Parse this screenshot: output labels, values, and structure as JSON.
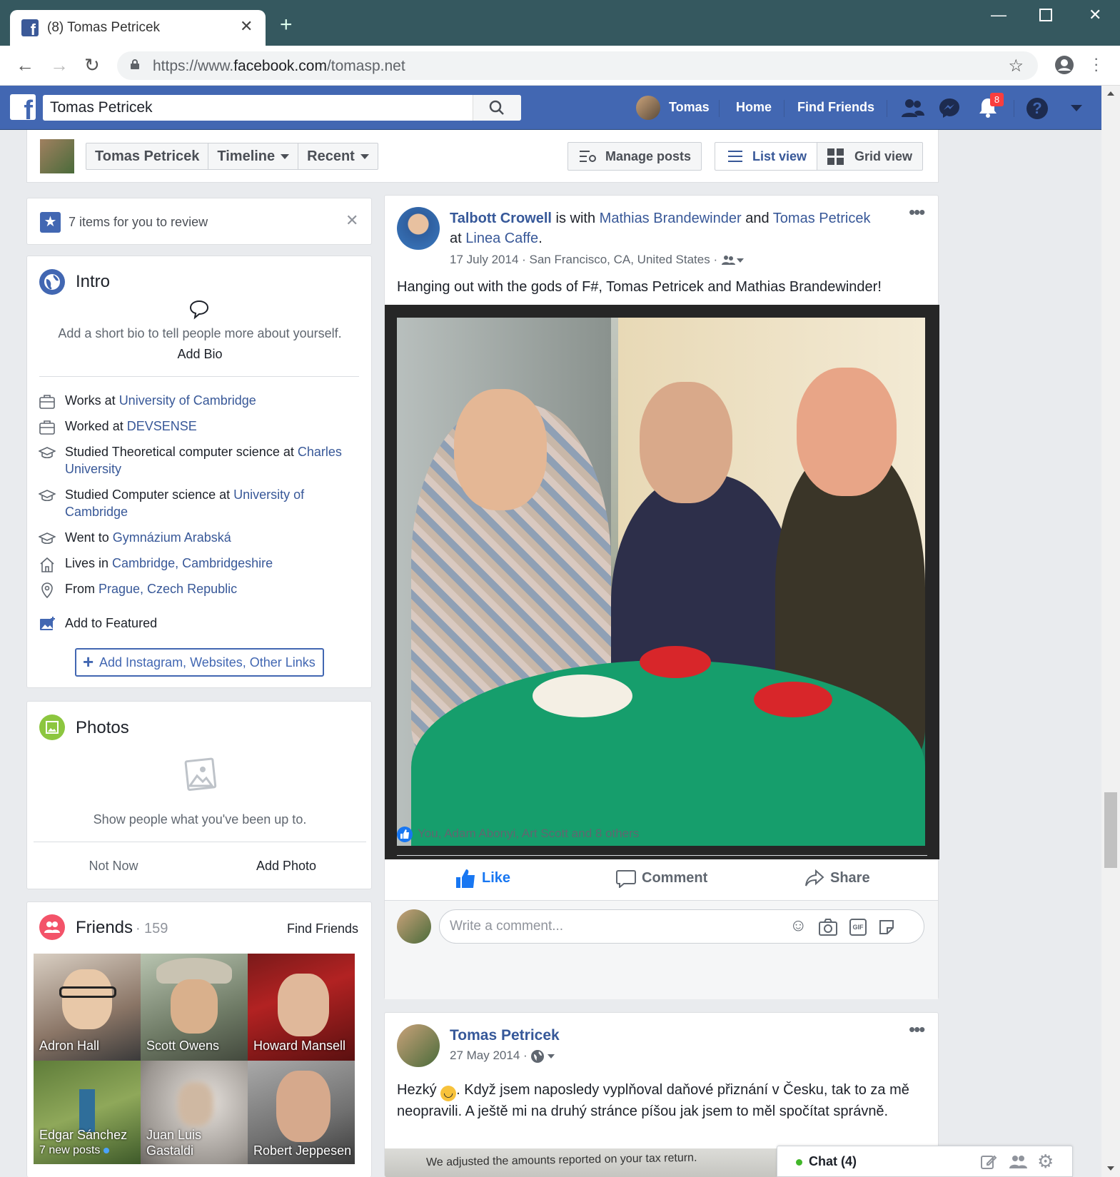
{
  "browser": {
    "tab_title": "(8) Tomas Petricek",
    "url_prefix": "https://www.",
    "url_domain": "facebook.com",
    "url_path": "/tomasp.net"
  },
  "fb_nav": {
    "search_value": "Tomas Petricek",
    "user": "Tomas",
    "home": "Home",
    "find_friends": "Find Friends",
    "notification_count": "8"
  },
  "profile_bar": {
    "name": "Tomas Petricek",
    "timeline": "Timeline",
    "recent": "Recent",
    "manage_posts": "Manage posts",
    "list_view": "List view",
    "grid_view": "Grid view"
  },
  "review": {
    "text": "7 items for you to review"
  },
  "intro": {
    "title": "Intro",
    "bio_prompt": "Add a short bio to tell people more about yourself.",
    "add_bio": "Add Bio",
    "items": [
      {
        "icon": "briefcase-icon",
        "prefix": "Works at ",
        "link": "University of Cambridge"
      },
      {
        "icon": "briefcase-icon",
        "prefix": "Worked at ",
        "link": "DEVSENSE"
      },
      {
        "icon": "graduation-cap-icon",
        "prefix": "Studied Theoretical computer science at ",
        "link": "Charles University"
      },
      {
        "icon": "graduation-cap-icon",
        "prefix": "Studied Computer science at ",
        "link": "University of Cambridge"
      },
      {
        "icon": "graduation-cap-icon",
        "prefix": "Went to ",
        "link": "Gymnázium Arabská"
      },
      {
        "icon": "home-icon",
        "prefix": "Lives in ",
        "link": "Cambridge, Cambridgeshire"
      },
      {
        "icon": "location-pin-icon",
        "prefix": "From ",
        "link": "Prague, Czech Republic"
      }
    ],
    "add_featured": "Add to Featured",
    "add_links": "Add Instagram, Websites, Other Links"
  },
  "photos": {
    "title": "Photos",
    "empty_text": "Show people what you've been up to.",
    "not_now": "Not Now",
    "add_photo": "Add Photo"
  },
  "friends": {
    "title": "Friends",
    "count": "159",
    "find_friends": "Find Friends",
    "list": [
      {
        "name": "Adron Hall",
        "sub": ""
      },
      {
        "name": "Scott Owens",
        "sub": ""
      },
      {
        "name": "Howard Mansell",
        "sub": ""
      },
      {
        "name": "Edgar Sánchez",
        "sub": "7 new posts"
      },
      {
        "name": "Juan Luis Gastaldi",
        "sub": ""
      },
      {
        "name": "Robert Jeppesen",
        "sub": ""
      }
    ]
  },
  "post1": {
    "author": "Talbott Crowell",
    "with_text": " is with ",
    "with1": "Mathias Brandewinder",
    "and_text": " and ",
    "with2": "Tomas Petricek",
    "at_text": "at ",
    "place": "Linea Caffe",
    "date": "17 July 2014",
    "location": "San Francisco, CA, United States",
    "text": "Hanging out with the gods of F#, Tomas Petricek and Mathias Brandewinder!",
    "likes": "You, Adam Abonyi, Art Scott and 8 others",
    "like": "Like",
    "comment": "Comment",
    "share": "Share",
    "comment_placeholder": "Write a comment..."
  },
  "post2": {
    "author": "Tomas Petricek",
    "date": "27 May 2014",
    "text_a": "Hezký ",
    "text_b": ". Když jsem naposledy vyplňoval daňové přiznání v Česku, tak to za mě neopravili. A ještě mi na druhý stránce píšou jak jsem to měl spočítat správně.",
    "image_text": "We adjusted the amounts reported on your tax return."
  },
  "chat": {
    "label": "Chat (4)"
  },
  "colors": {
    "fb_blue": "#4267b2",
    "link": "#385898",
    "chrome_bar": "#35585f",
    "notification": "#fa3e3e",
    "online": "#42b72a"
  }
}
